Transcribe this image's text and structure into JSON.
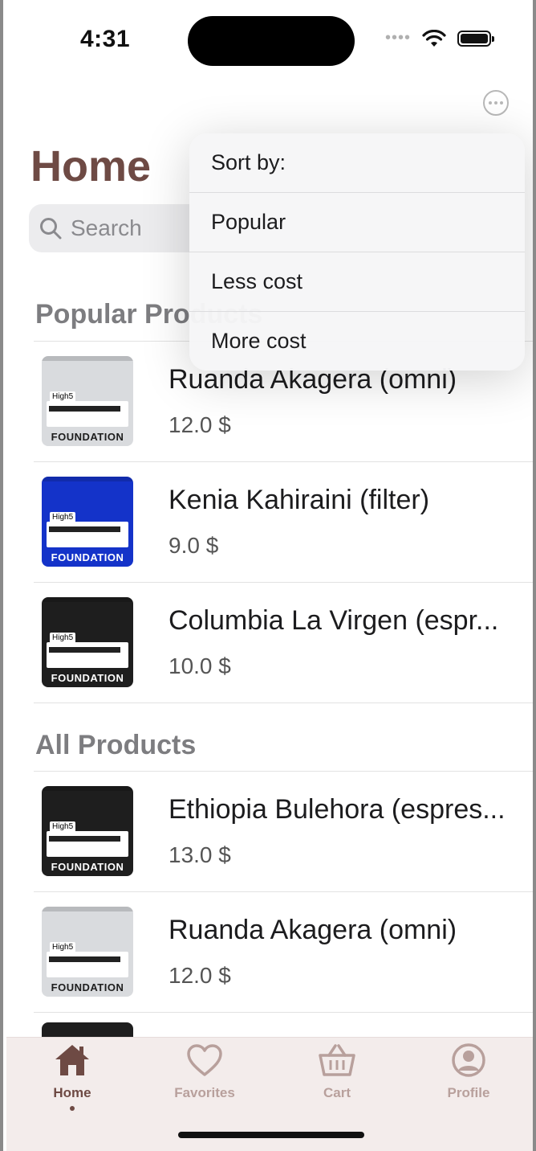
{
  "status_bar": {
    "time": "4:31",
    "signal": "••••"
  },
  "header": {
    "title": "Home",
    "more_icon": "ellipsis-circle-icon"
  },
  "search": {
    "placeholder": "Search"
  },
  "sections": {
    "popular": "Popular Products",
    "all": "All Products"
  },
  "popular_products": [
    {
      "name": "Ruanda Akagera (omni)",
      "price": "12.0 $",
      "bag": "#d9dbde",
      "label": "РУАНДА AKAGERA",
      "foot_color": "#1d1d1d"
    },
    {
      "name": "Kenia Kahiraini (filter)",
      "price": "9.0 $",
      "bag": "#1433c9",
      "label": "КЕНІЯ KAHIRAINI",
      "foot_color": "#ffffff"
    },
    {
      "name": "Columbia La Virgen (espr...",
      "price": "10.0 $",
      "bag": "#1e1e1e",
      "label": "КОЛУМБІЯ LA VIRGEN",
      "foot_color": "#ffffff"
    }
  ],
  "all_products": [
    {
      "name": "Ethiopia Bulehora (espres...",
      "price": "13.0 $",
      "bag": "#1e1e1e",
      "label": "ЕФІОПІЯ BULEHORA",
      "foot_color": "#ffffff"
    },
    {
      "name": "Ruanda Akagera (omni)",
      "price": "12.0 $",
      "bag": "#d9dbde",
      "label": "РУАНДА AKAGERA",
      "foot_color": "#1d1d1d"
    }
  ],
  "package": {
    "brand": "High5",
    "foot": "FOUNDATION"
  },
  "sort_menu": {
    "title": "Sort by:",
    "options": [
      "Popular",
      "Less cost",
      "More cost"
    ]
  },
  "tabbar": {
    "tabs": [
      {
        "label": "Home",
        "icon": "house-icon",
        "active": true
      },
      {
        "label": "Favorites",
        "icon": "heart-icon",
        "active": false
      },
      {
        "label": "Cart",
        "icon": "basket-icon",
        "active": false
      },
      {
        "label": "Profile",
        "icon": "person-circle-icon",
        "active": false
      }
    ]
  },
  "colors": {
    "accent": "#6e4a44",
    "tab_inactive": "#b8a09c",
    "tab_bg": "#f3eceb"
  }
}
